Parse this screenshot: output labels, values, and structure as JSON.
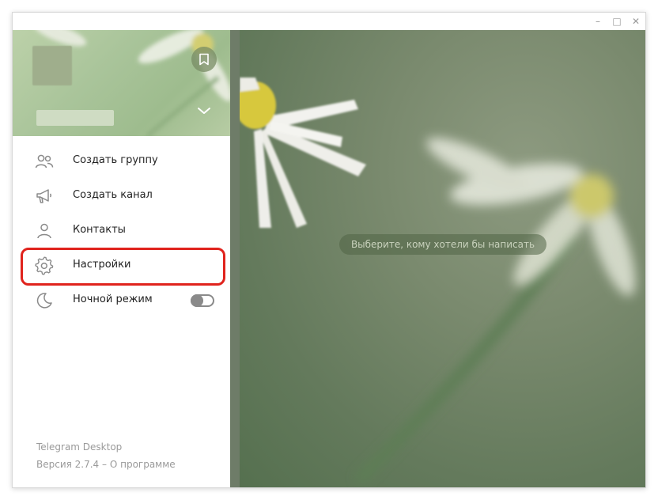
{
  "window": {
    "controls": {
      "minimize": "–",
      "maximize": "□",
      "close": "✕"
    }
  },
  "drawer": {
    "menu": [
      {
        "label": "Создать группу",
        "icon": "group-icon"
      },
      {
        "label": "Создать канал",
        "icon": "megaphone-icon"
      },
      {
        "label": "Контакты",
        "icon": "person-icon"
      },
      {
        "label": "Настройки",
        "icon": "gear-icon",
        "highlighted": true
      },
      {
        "label": "Ночной режим",
        "icon": "moon-icon",
        "toggle": false
      }
    ],
    "footer": {
      "app_name": "Telegram Desktop",
      "version": "Версия 2.7.4",
      "separator": " – ",
      "about": "О программе"
    }
  },
  "chat": {
    "placeholder": "Выберите, кому хотели бы написать"
  },
  "colors": {
    "highlight": "#e0231d",
    "chat_bg": "#7a8a6e"
  }
}
